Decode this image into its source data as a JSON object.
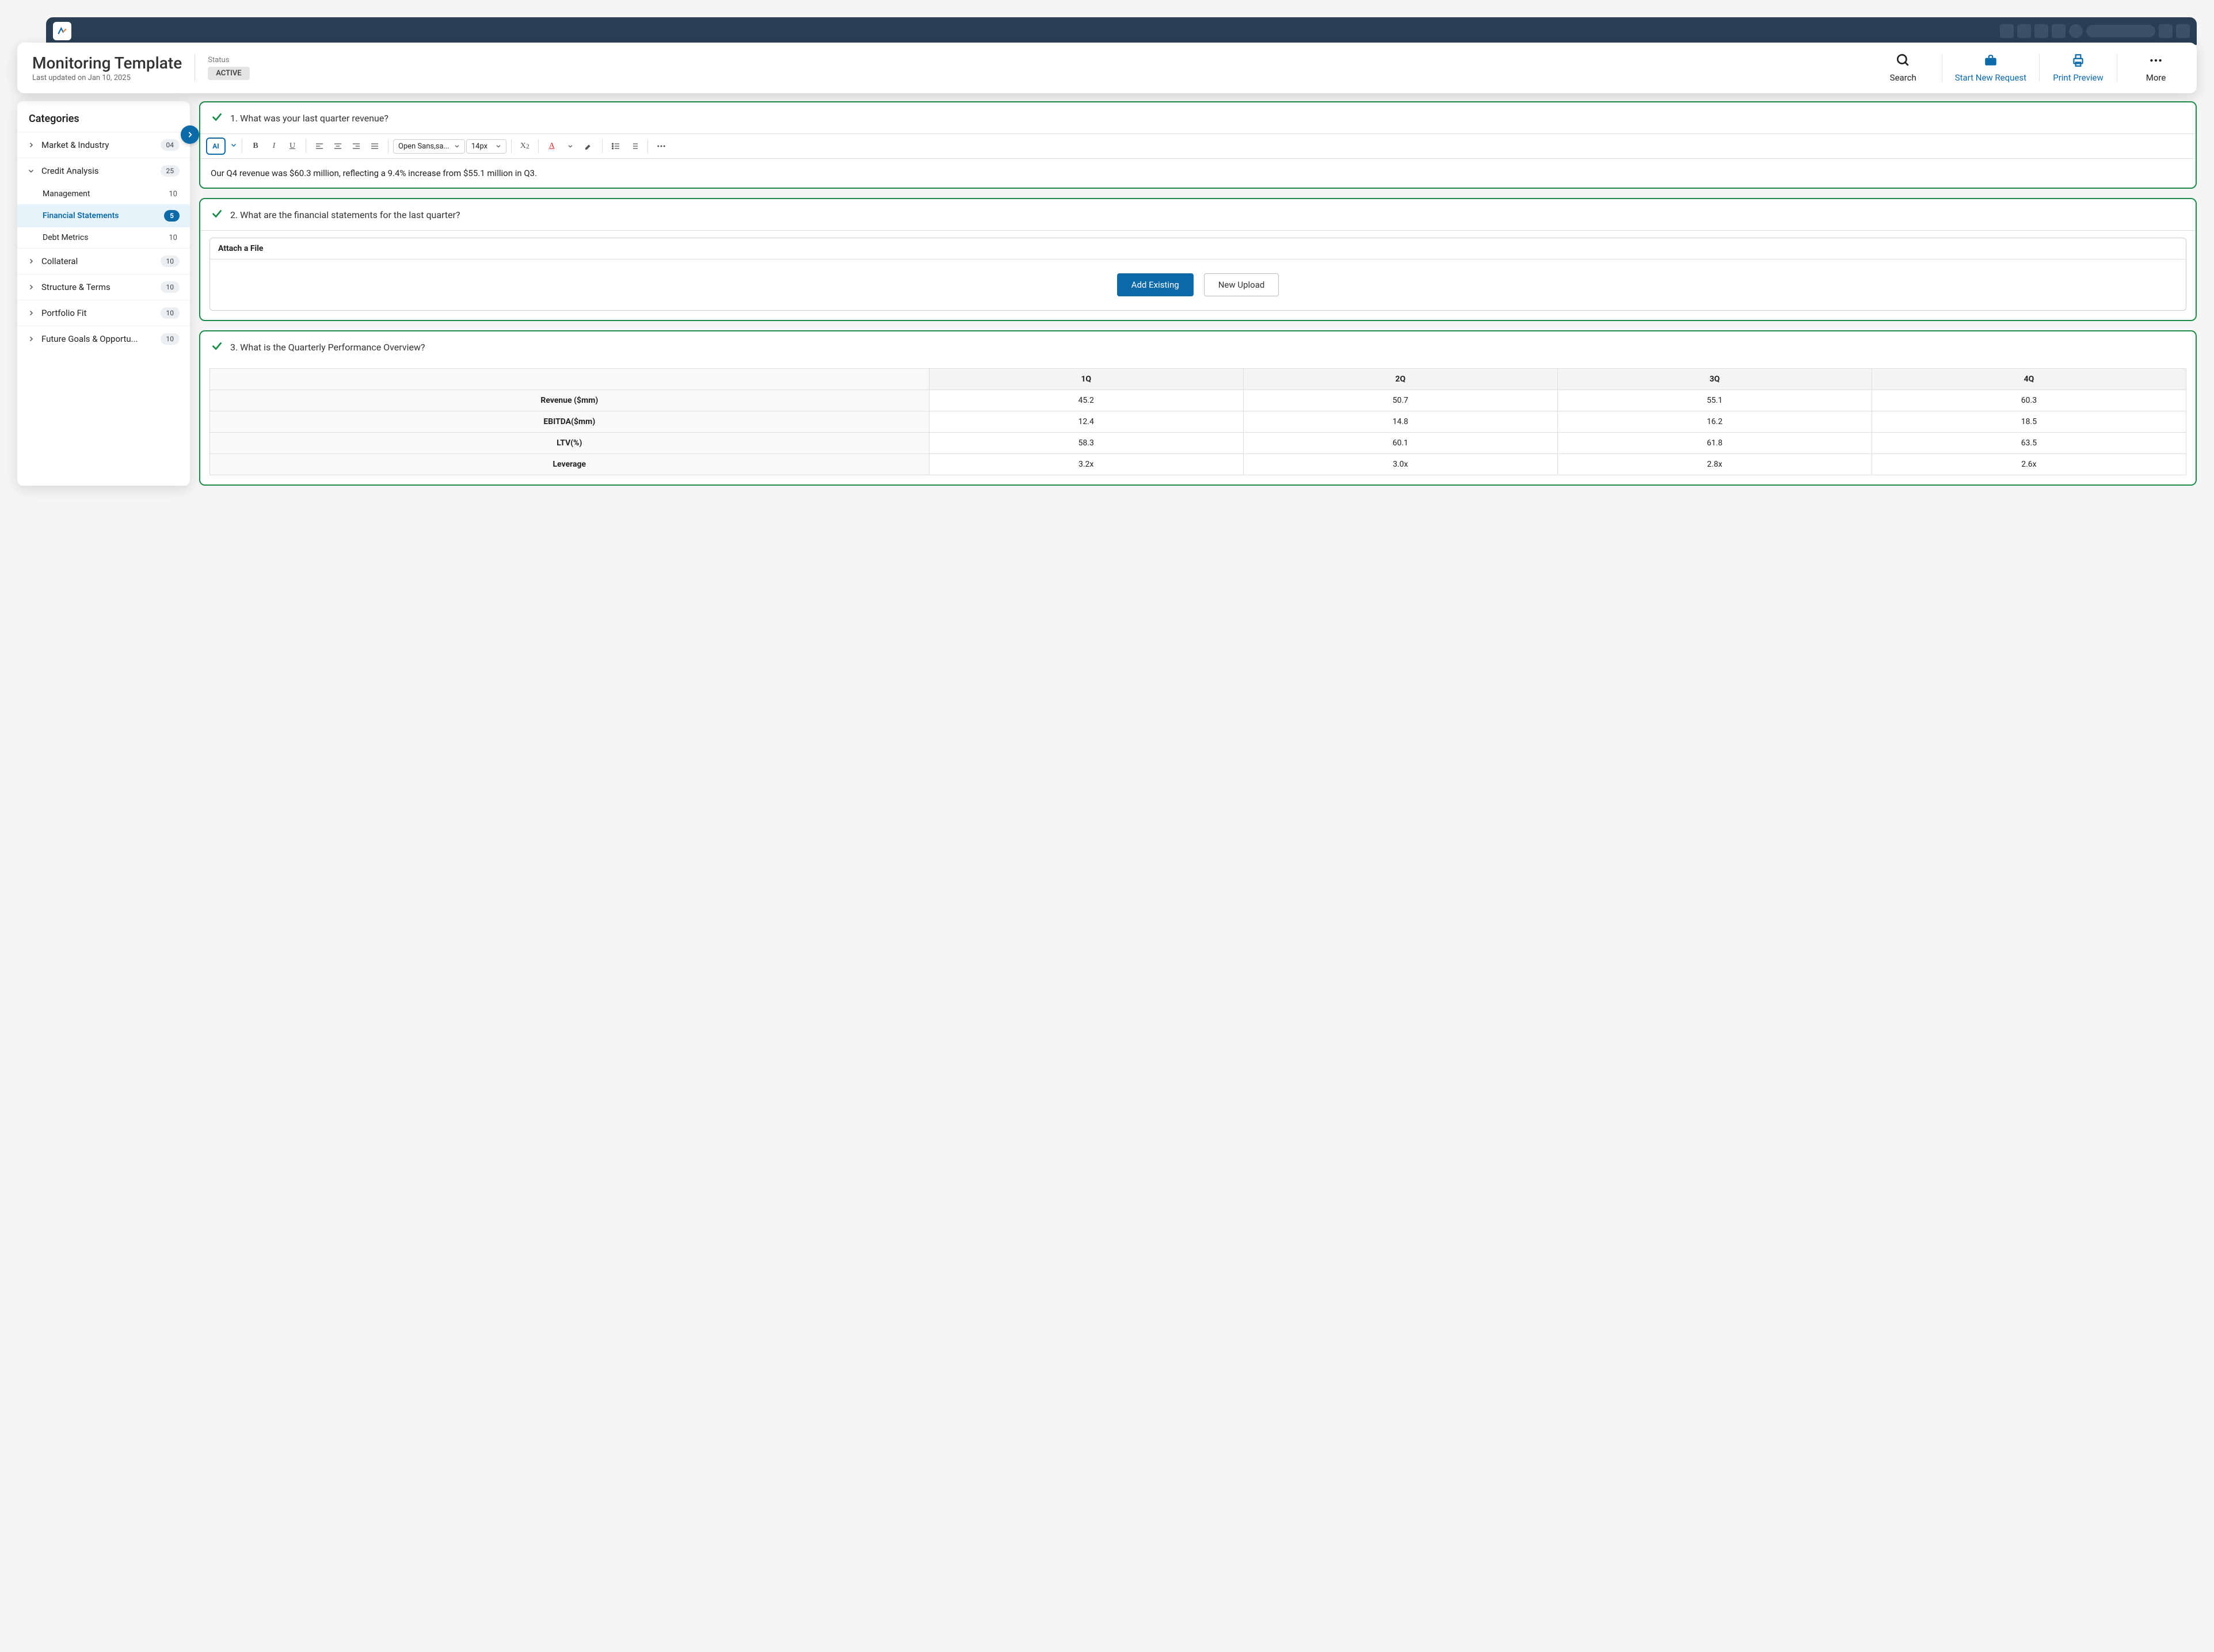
{
  "header": {
    "title": "Monitoring Template",
    "subtitle": "Last updated on Jan 10, 2025",
    "status_label": "Status",
    "status_value": "ACTIVE",
    "actions": {
      "search": "Search",
      "new_request": "Start New Request",
      "print": "Print Preview",
      "more": "More"
    }
  },
  "sidebar": {
    "title": "Categories",
    "items": [
      {
        "label": "Market & Industry",
        "count": "04",
        "expanded": false
      },
      {
        "label": "Credit Analysis",
        "count": "25",
        "expanded": true,
        "children": [
          {
            "label": "Management",
            "count": "10",
            "active": false
          },
          {
            "label": "Financial Statements",
            "count": "5",
            "active": true
          },
          {
            "label": "Debt Metrics",
            "count": "10",
            "active": false
          }
        ]
      },
      {
        "label": "Collateral",
        "count": "10",
        "expanded": false
      },
      {
        "label": "Structure & Terms",
        "count": "10",
        "expanded": false
      },
      {
        "label": "Portfolio Fit",
        "count": "10",
        "expanded": false
      },
      {
        "label": "Future Goals & Opportu...",
        "count": "10",
        "expanded": false
      }
    ]
  },
  "toolbar": {
    "font_family": "Open Sans,sa...",
    "font_size": "14px"
  },
  "questions": {
    "q1": {
      "text": "1. What was your last quarter revenue?",
      "answer": "Our Q4 revenue was $60.3 million, reflecting a 9.4% increase from $55.1 million in Q3."
    },
    "q2": {
      "text": "2. What are the financial statements for the last quarter?",
      "attach_label": "Attach a File",
      "add_existing": "Add Existing",
      "new_upload": "New Upload"
    },
    "q3": {
      "text": "3. What is the Quarterly Performance Overview?"
    }
  },
  "chart_data": {
    "type": "table",
    "columns": [
      "1Q",
      "2Q",
      "3Q",
      "4Q"
    ],
    "rows": [
      {
        "label": "Revenue ($mm)",
        "values": [
          "45.2",
          "50.7",
          "55.1",
          "60.3"
        ]
      },
      {
        "label": "EBITDA($mm)",
        "values": [
          "12.4",
          "14.8",
          "16.2",
          "18.5"
        ]
      },
      {
        "label": "LTV(%)",
        "values": [
          "58.3",
          "60.1",
          "61.8",
          "63.5"
        ]
      },
      {
        "label": "Leverage",
        "values": [
          "3.2x",
          "3.0x",
          "2.8x",
          "2.6x"
        ]
      }
    ]
  }
}
